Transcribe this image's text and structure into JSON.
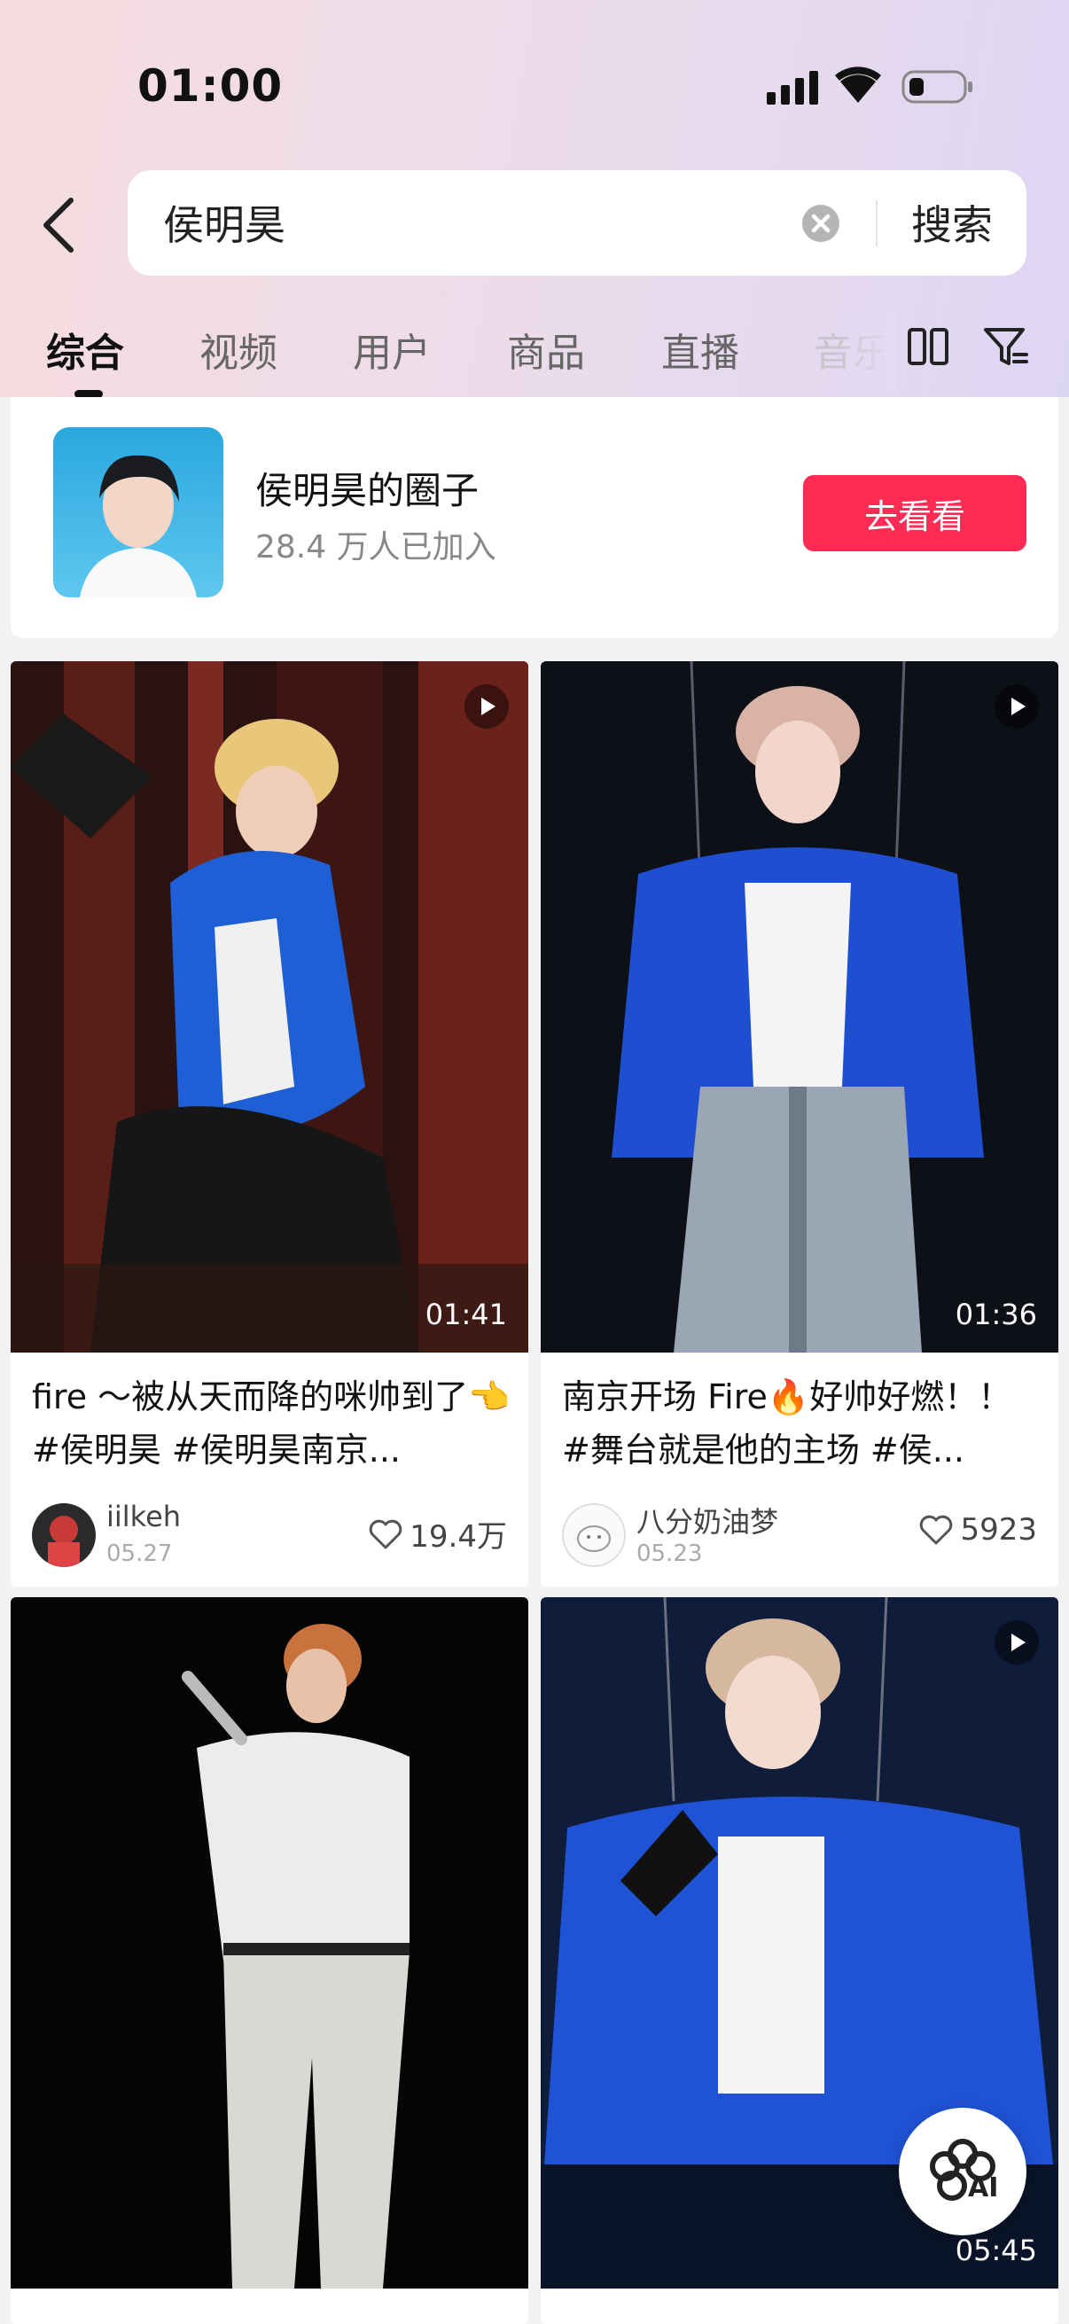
{
  "status_bar": {
    "time": "01:00"
  },
  "search": {
    "query": "侯明昊",
    "button": "搜索"
  },
  "tabs": [
    {
      "label": "综合",
      "active": true
    },
    {
      "label": "视频"
    },
    {
      "label": "用户"
    },
    {
      "label": "商品"
    },
    {
      "label": "直播"
    },
    {
      "label": "音乐"
    }
  ],
  "circle": {
    "title": "侯明昊的圈子",
    "subtitle": "28.4 万人已加入",
    "button": "去看看"
  },
  "cards": [
    {
      "title": "fire ～被从天而降的咪帅到了👈 #侯明昊 #侯明昊南京...",
      "author": "iilkeh",
      "date": "05.27",
      "likes": "19.4万",
      "duration": "01:41"
    },
    {
      "title": "南京开场 Fire🔥好帅好燃！！ #舞台就是他的主场 #侯...",
      "author": "八分奶油梦",
      "date": "05.23",
      "likes": "5923",
      "duration": "01:36"
    },
    {
      "title": "",
      "author": "",
      "date": "",
      "likes": "",
      "duration": ""
    },
    {
      "title": "",
      "author": "",
      "date": "",
      "likes": "",
      "duration": "05:45"
    }
  ],
  "colors": {
    "accent": "#fe2c55",
    "header_gradient": [
      "#f6dcdf",
      "#ddd6f3"
    ]
  },
  "icons": [
    "back-icon",
    "clear-icon",
    "grid-icon",
    "filter-icon",
    "play-icon",
    "heart-icon",
    "ai-assistant-icon"
  ]
}
